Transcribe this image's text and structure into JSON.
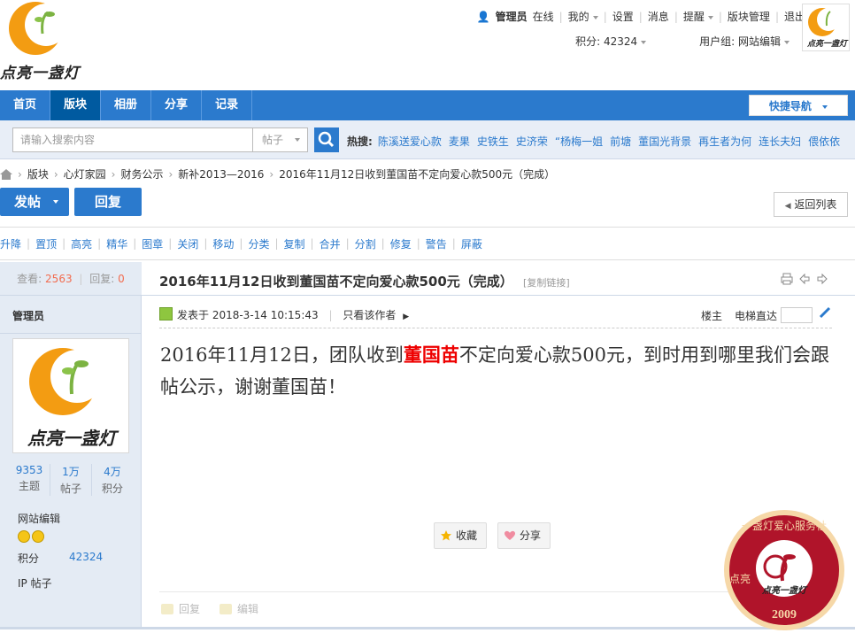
{
  "site": {
    "logo_text": "点亮一盏灯",
    "seal_text_top": "一盏灯爱心服务社",
    "seal_text_left": "点亮",
    "seal_year": "2009"
  },
  "topbar": {
    "user": "管理员",
    "status": "在线",
    "mine": "我的",
    "settings": "设置",
    "messages": "消息",
    "reminders": "提醒",
    "block_manage": "版块管理",
    "logout": "退出",
    "points_label": "积分: 42324",
    "usergroup_label": "用户组: 网站编辑"
  },
  "nav": {
    "items": [
      "首页",
      "版块",
      "相册",
      "分享",
      "记录"
    ],
    "quick_nav": "快捷导航"
  },
  "search": {
    "placeholder": "请输入搜索内容",
    "type": "帖子",
    "hot_label": "热搜:",
    "hot_items": [
      "陈溪送爱心款",
      "麦果",
      "史铁生",
      "史济荣",
      "“杨梅一姐",
      "前塘",
      "董国光背景",
      "再生者为何",
      "连长夫妇",
      "偎依依"
    ]
  },
  "breadcrumb": [
    "版块",
    "心灯家园",
    "财务公示",
    "新补2013—2016",
    "2016年11月12日收到董国苗不定向爱心款500元（完成）"
  ],
  "actions": {
    "post": "发帖",
    "reply": "回复",
    "back": "返回列表"
  },
  "mod_tools": [
    "升降",
    "置顶",
    "高亮",
    "精华",
    "图章",
    "关闭",
    "移动",
    "分类",
    "复制",
    "合并",
    "分割",
    "修复",
    "警告",
    "屏蔽"
  ],
  "thread": {
    "views_label": "查看:",
    "views": "2563",
    "replies_label": "回复:",
    "replies": "0",
    "title": "2016年11月12日收到董国苗不定向爱心款500元（完成）",
    "copy_link": "[复制链接]"
  },
  "author": {
    "name": "管理员",
    "avatar_text": "点亮一盏灯",
    "stats": [
      {
        "num": "9353",
        "label": "主题"
      },
      {
        "num": "1万",
        "label": "帖子"
      },
      {
        "num": "4万",
        "label": "积分"
      }
    ],
    "group": "网站编辑",
    "points_label": "积分",
    "points": "42324",
    "ip_label": "IP 帖子"
  },
  "post": {
    "posted_at": "发表于 2018-3-14 10:15:43",
    "only_author": "只看该作者",
    "floor": "楼主",
    "jump": "电梯直达",
    "body_pre": "2016年11月12日，团队收到",
    "body_name": "董国苗",
    "body_post": "不定向爱心款500元，到时用到哪里我们会跟帖公示，谢谢董国苗！",
    "fav": "收藏",
    "share": "分享",
    "reply": "回复",
    "edit": "编辑"
  },
  "colors": {
    "primary": "#2b7acd",
    "highlight": "#e00000",
    "sidebar_bg": "#e4ebf4"
  }
}
